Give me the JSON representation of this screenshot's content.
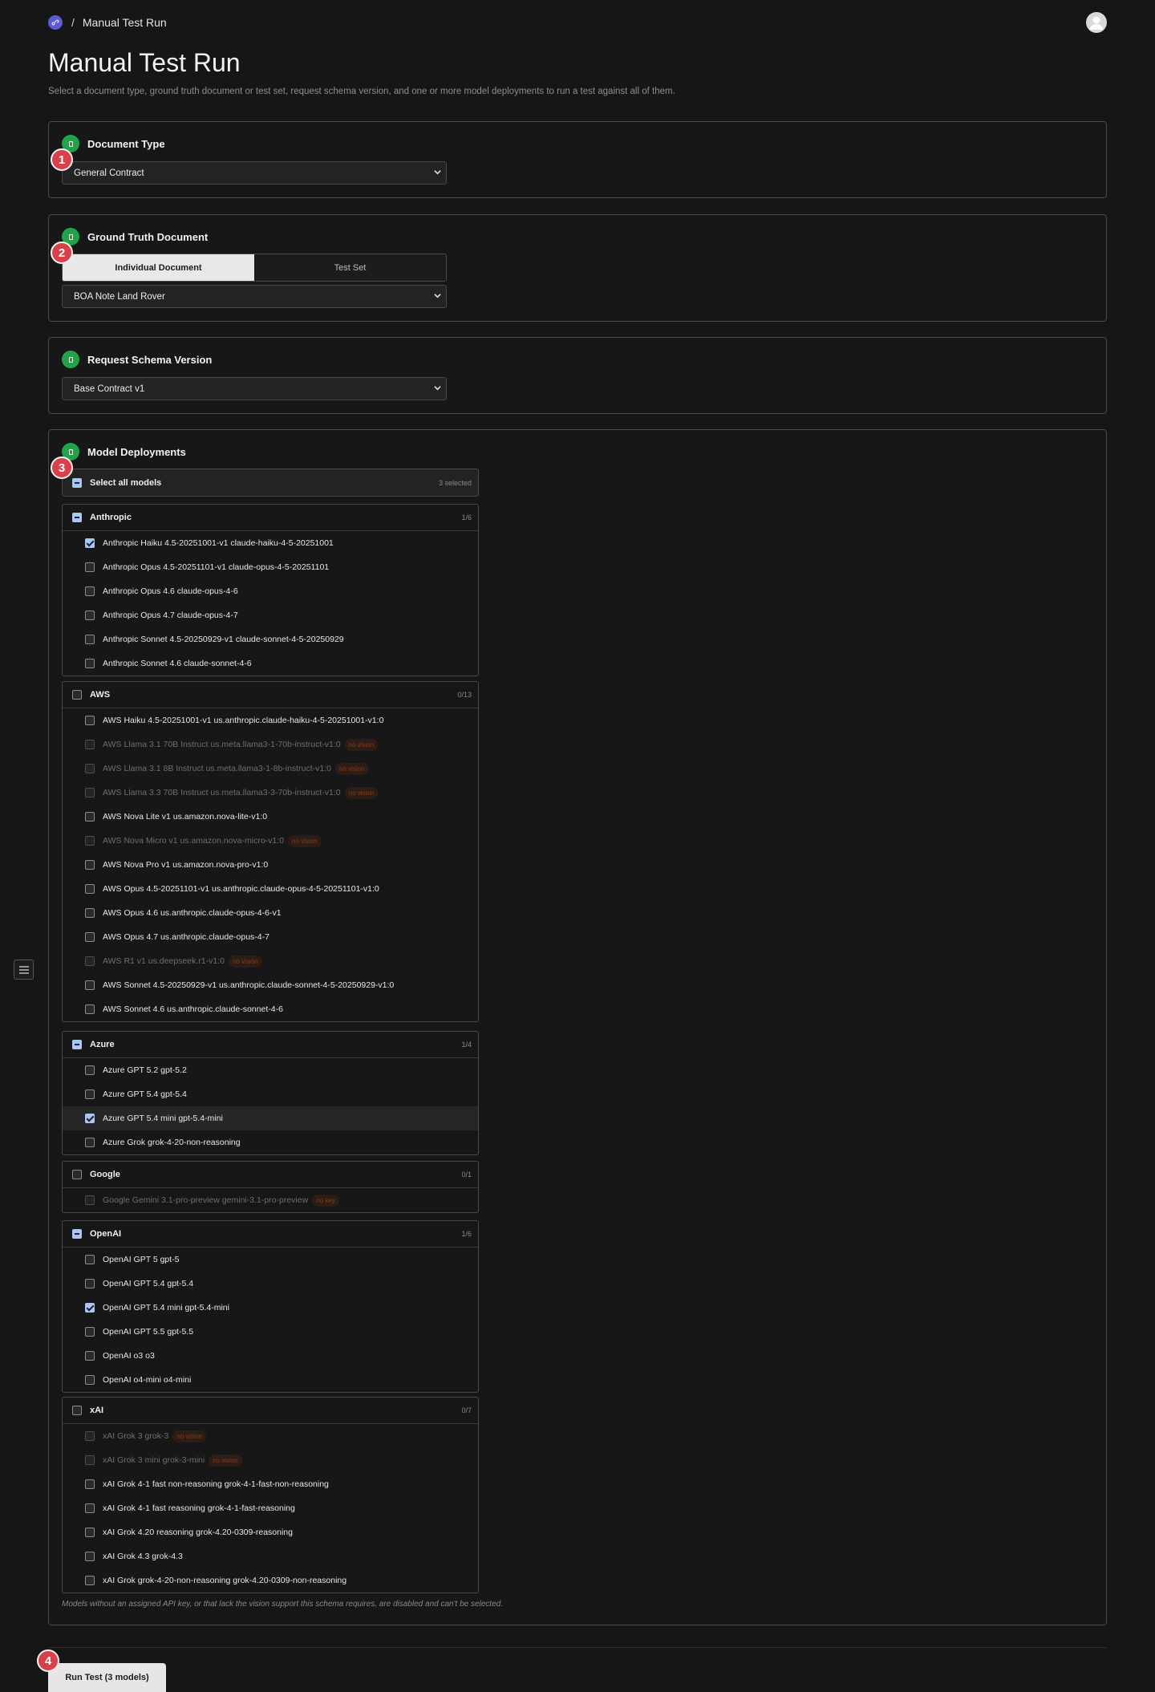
{
  "breadcrumb": {
    "separator": "/",
    "current": "Manual Test Run"
  },
  "page": {
    "title": "Manual Test Run",
    "subtitle": "Select a document type, ground truth document or test set, request schema version, and one or more model deployments to run a test against all of them."
  },
  "steps": [
    "1",
    "2",
    "3",
    "4"
  ],
  "document_type": {
    "title": "Document Type",
    "selected": "General Contract"
  },
  "ground_truth": {
    "title": "Ground Truth Document",
    "tabs": [
      "Individual Document",
      "Test Set"
    ],
    "active_tab": "Individual Document",
    "selected": "BOA Note Land Rover"
  },
  "schema_version": {
    "title": "Request Schema Version",
    "selected": "Base Contract v1"
  },
  "models": {
    "title": "Model Deployments",
    "select_all_label": "Select all models",
    "selected_count": "3 selected",
    "groups": [
      {
        "name": "Anthropic",
        "count": "1/6",
        "state": "partial",
        "items": [
          {
            "label": "Anthropic Haiku 4.5-20251001-v1 claude-haiku-4-5-20251001",
            "checked": true
          },
          {
            "label": "Anthropic Opus 4.5-20251101-v1 claude-opus-4-5-20251101",
            "checked": false
          },
          {
            "label": "Anthropic Opus 4.6 claude-opus-4-6",
            "checked": false
          },
          {
            "label": "Anthropic Opus 4.7 claude-opus-4-7",
            "checked": false
          },
          {
            "label": "Anthropic Sonnet 4.5-20250929-v1 claude-sonnet-4-5-20250929",
            "checked": false
          },
          {
            "label": "Anthropic Sonnet 4.6 claude-sonnet-4-6",
            "checked": false
          }
        ]
      },
      {
        "name": "AWS",
        "count": "0/13",
        "state": "none",
        "items": [
          {
            "label": "AWS Haiku 4.5-20251001-v1 us.anthropic.claude-haiku-4-5-20251001-v1:0",
            "checked": false
          },
          {
            "label": "AWS Llama 3.1 70B Instruct us.meta.llama3-1-70b-instruct-v1:0",
            "checked": false,
            "disabled": true,
            "badge": "no vision"
          },
          {
            "label": "AWS Llama 3.1 8B Instruct us.meta.llama3-1-8b-instruct-v1:0",
            "checked": false,
            "disabled": true,
            "badge": "no vision"
          },
          {
            "label": "AWS Llama 3.3 70B Instruct us.meta.llama3-3-70b-instruct-v1:0",
            "checked": false,
            "disabled": true,
            "badge": "no vision"
          },
          {
            "label": "AWS Nova Lite v1 us.amazon.nova-lite-v1:0",
            "checked": false
          },
          {
            "label": "AWS Nova Micro v1 us.amazon.nova-micro-v1:0",
            "checked": false,
            "disabled": true,
            "badge": "no vision"
          },
          {
            "label": "AWS Nova Pro v1 us.amazon.nova-pro-v1:0",
            "checked": false
          },
          {
            "label": "AWS Opus 4.5-20251101-v1 us.anthropic.claude-opus-4-5-20251101-v1:0",
            "checked": false
          },
          {
            "label": "AWS Opus 4.6 us.anthropic.claude-opus-4-6-v1",
            "checked": false
          },
          {
            "label": "AWS Opus 4.7 us.anthropic.claude-opus-4-7",
            "checked": false
          },
          {
            "label": "AWS R1 v1 us.deepseek.r1-v1:0",
            "checked": false,
            "disabled": true,
            "badge": "no vision"
          },
          {
            "label": "AWS Sonnet 4.5-20250929-v1 us.anthropic.claude-sonnet-4-5-20250929-v1:0",
            "checked": false
          },
          {
            "label": "AWS Sonnet 4.6 us.anthropic.claude-sonnet-4-6",
            "checked": false
          }
        ]
      },
      {
        "name": "Azure",
        "count": "1/4",
        "state": "partial",
        "items": [
          {
            "label": "Azure GPT 5.2 gpt-5.2",
            "checked": false
          },
          {
            "label": "Azure GPT 5.4 gpt-5.4",
            "checked": false
          },
          {
            "label": "Azure GPT 5.4 mini gpt-5.4-mini",
            "checked": true,
            "highlight": true
          },
          {
            "label": "Azure Grok grok-4-20-non-reasoning",
            "checked": false
          }
        ]
      },
      {
        "name": "Google",
        "count": "0/1",
        "state": "none",
        "items": [
          {
            "label": "Google Gemini 3.1-pro-preview gemini-3.1-pro-preview",
            "checked": false,
            "disabled": true,
            "badge": "no key"
          }
        ]
      },
      {
        "name": "OpenAI",
        "count": "1/6",
        "state": "partial",
        "items": [
          {
            "label": "OpenAI GPT 5 gpt-5",
            "checked": false
          },
          {
            "label": "OpenAI GPT 5.4 gpt-5.4",
            "checked": false
          },
          {
            "label": "OpenAI GPT 5.4 mini gpt-5.4-mini",
            "checked": true
          },
          {
            "label": "OpenAI GPT 5.5 gpt-5.5",
            "checked": false
          },
          {
            "label": "OpenAI o3 o3",
            "checked": false
          },
          {
            "label": "OpenAI o4-mini o4-mini",
            "checked": false
          }
        ]
      },
      {
        "name": "xAI",
        "count": "0/7",
        "state": "none",
        "items": [
          {
            "label": "xAI Grok 3 grok-3",
            "checked": false,
            "disabled": true,
            "badge": "no vision"
          },
          {
            "label": "xAI Grok 3 mini grok-3-mini",
            "checked": false,
            "disabled": true,
            "badge": "no vision"
          },
          {
            "label": "xAI Grok 4-1 fast non-reasoning grok-4-1-fast-non-reasoning",
            "checked": false
          },
          {
            "label": "xAI Grok 4-1 fast reasoning grok-4-1-fast-reasoning",
            "checked": false
          },
          {
            "label": "xAI Grok 4.20 reasoning grok-4.20-0309-reasoning",
            "checked": false
          },
          {
            "label": "xAI Grok 4.3 grok-4.3",
            "checked": false
          },
          {
            "label": "xAI Grok grok-4-20-non-reasoning grok-4.20-0309-non-reasoning",
            "checked": false
          }
        ]
      }
    ],
    "note": "Models without an assigned API key, or that lack the vision support this schema requires, are disabled and can't be selected."
  },
  "run_button_label": "Run Test (3 models)",
  "colors": {
    "accent_green": "#22a34a",
    "step_red": "#d9404a",
    "checkbox_blue": "#a9c7ef",
    "logo_purple": "#5b5bd6"
  },
  "icons": {
    "logo": "link-icon",
    "avatar": "user-icon",
    "section_status": "document-icon",
    "sidebar": "menu-icon",
    "select": "chevron-down-icon"
  }
}
